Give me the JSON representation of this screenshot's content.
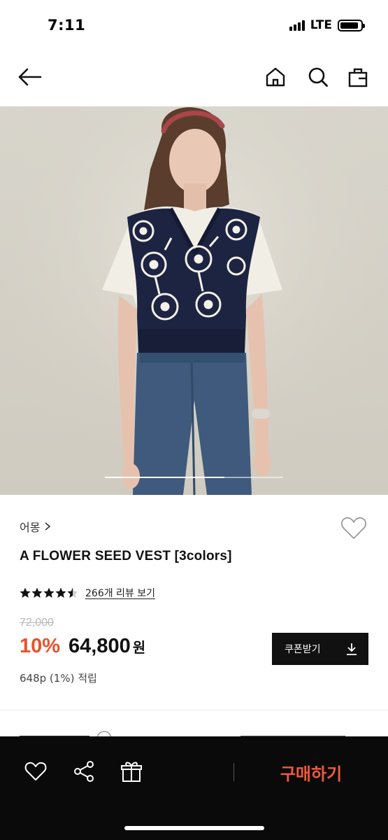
{
  "status": {
    "time": "7:11",
    "network": "LTE"
  },
  "product": {
    "brand": "어몽",
    "name": "A FLOWER SEED VEST [3colors]",
    "rating": 4.5,
    "review_link": "266개 리뷰 보기",
    "original_price": "72,000",
    "discount": "10%",
    "sale_price": "64,800",
    "currency": "원",
    "points": "648p (1%) 적립"
  },
  "carousel": {
    "position": 0.67
  },
  "coupon": {
    "label": "쿠폰받기"
  },
  "bottom_bar": {
    "buy_label": "구매하기"
  },
  "colors": {
    "accent": "#e8512b",
    "buy": "#ee5a3c",
    "dark": "#0a0a0a"
  }
}
